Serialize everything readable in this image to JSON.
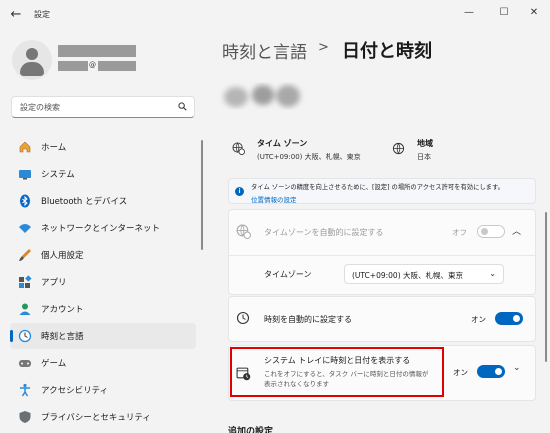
{
  "window": {
    "app_title": "設定",
    "back_icon": "arrow-left-icon",
    "controls": [
      "minimize-icon",
      "maximize-icon",
      "close-icon"
    ]
  },
  "profile": {
    "email_at": "@"
  },
  "search": {
    "placeholder": "設定の検索"
  },
  "nav": {
    "items": [
      {
        "label": "ホーム",
        "icon": "home-icon"
      },
      {
        "label": "システム",
        "icon": "system-icon"
      },
      {
        "label": "Bluetooth とデバイス",
        "icon": "bluetooth-icon"
      },
      {
        "label": "ネットワークとインターネット",
        "icon": "wifi-icon"
      },
      {
        "label": "個人用設定",
        "icon": "brush-icon"
      },
      {
        "label": "アプリ",
        "icon": "apps-icon"
      },
      {
        "label": "アカウント",
        "icon": "account-icon"
      },
      {
        "label": "時刻と言語",
        "icon": "time-language-icon",
        "active": true
      },
      {
        "label": "ゲーム",
        "icon": "gamepad-icon"
      },
      {
        "label": "アクセシビリティ",
        "icon": "accessibility-icon"
      },
      {
        "label": "プライバシーとセキュリティ",
        "icon": "shield-icon"
      }
    ]
  },
  "header": {
    "parent": "時刻と言語",
    "separator": ">",
    "current": "日付と時刻"
  },
  "summary": {
    "timezone": {
      "title": "タイム ゾーン",
      "value": "(UTC+09:00) 大阪、札幌、東京"
    },
    "region": {
      "title": "地域",
      "value": "日本"
    }
  },
  "notice": {
    "message": "タイム ゾーンの精度を向上させるために、[設定] の場所のアクセス許可を有効にします。",
    "link": "位置情報の設定"
  },
  "auto_timezone": {
    "label": "タイムゾーンを自動的に設定する",
    "state": "オフ"
  },
  "timezone_row": {
    "label": "タイムゾーン",
    "selected": "(UTC+09:00) 大阪、札幌、東京"
  },
  "auto_time": {
    "label": "時刻を自動的に設定する",
    "state": "オン"
  },
  "tray": {
    "label": "システム トレイに時刻と日付を表示する",
    "desc_line1": "これをオフにすると、タスク バーに時刻と日付の情報が",
    "desc_line2": "表示されなくなります",
    "state": "オン"
  },
  "more": {
    "heading": "追加の設定"
  },
  "colors": {
    "accent": "#0067c0",
    "highlight": "#e00000"
  }
}
